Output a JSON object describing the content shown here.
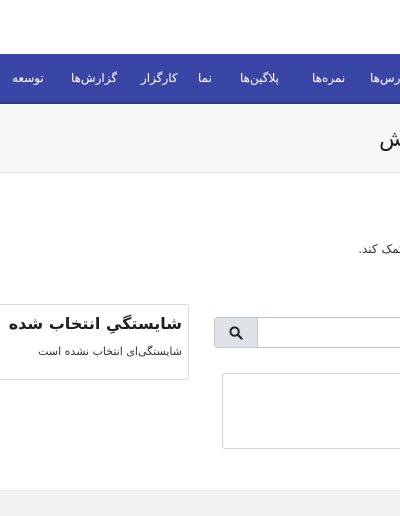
{
  "nav": {
    "items": [
      {
        "label": "توسعه"
      },
      {
        "label": "گزارش‌ها"
      },
      {
        "label": "کارگزار"
      },
      {
        "label": "نما"
      },
      {
        "label": "پلاگین‌ها"
      },
      {
        "label": "نمره‌ها"
      },
      {
        "label": "درس‌ها"
      }
    ]
  },
  "header": {
    "title": "ش"
  },
  "main": {
    "help_text": "ا کمک کند.",
    "search": {
      "value": "",
      "placeholder": ""
    },
    "card": {
      "heading": "شایستگیِ انتخاب شده",
      "text": "شایستگی‌ای انتخاب نشده است"
    }
  },
  "colors": {
    "navbar": "#3a46a5",
    "header_bg": "#f6f7f9",
    "search_button_bg": "#dfe3e8"
  },
  "icons": {
    "search": "search-icon"
  }
}
